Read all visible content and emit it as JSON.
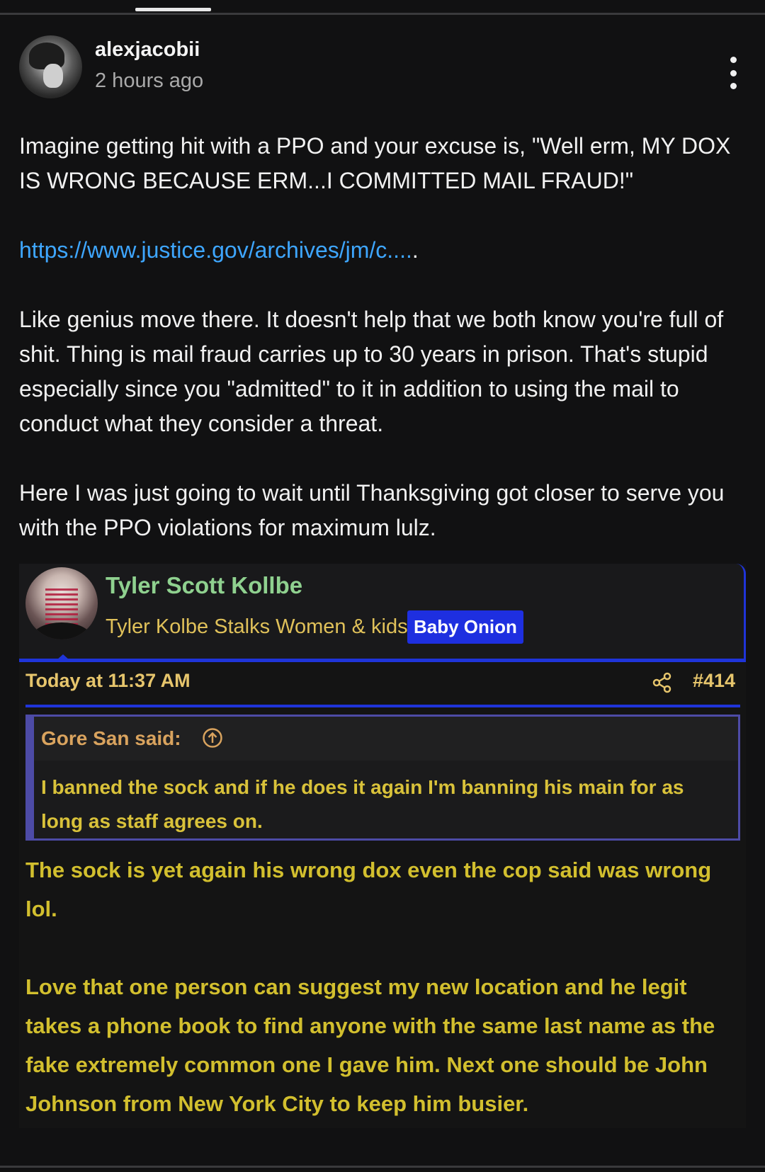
{
  "post": {
    "author": "alexjacobii",
    "timestamp": "2 hours ago",
    "paragraphs": [
      "Imagine getting hit with a PPO and your excuse is, \"Well erm, MY DOX IS WRONG BECAUSE ERM...I COMMITTED MAIL FRAUD!\"",
      "Like genius move there. It doesn't help that we both know you're full of shit. Thing is mail fraud carries up to 30 years in prison. That's stupid especially since you \"admitted\" to it in addition to using the mail to conduct what they consider a threat.",
      "Here I was just going to wait until Thanksgiving got closer to serve you with the PPO violations for maximum lulz."
    ],
    "link_text": "https://www.justice.gov/archives/jm/c....",
    "link_trailing": "."
  },
  "embed": {
    "name": "Tyler Scott Kollbe",
    "tagline": "Tyler Kolbe Stalks Women & kids.",
    "badge": "Baby Onion",
    "time": "Today at 11:37 AM",
    "post_number": "#414",
    "quote": {
      "author": "Gore San said:",
      "text": "I banned the sock and if he does it again I'm banning his main for as long as staff agrees on."
    },
    "reply": [
      "The sock is yet again his wrong dox even the cop said was wrong lol.",
      "Love that one person can suggest my new location and he legit takes a phone book to find anyone with the same last name as the fake extremely common one I gave him. Next one should be John Johnson from New York City to keep him busier."
    ]
  },
  "colors": {
    "background": "#111112",
    "link": "#3ea6ff",
    "embed_accent": "#1f34d9",
    "embed_name": "#8fd18f",
    "embed_gold": "#e6c56c",
    "reply_yellow": "#d2bf2e"
  },
  "icons": [
    "more-vertical-icon",
    "share-icon",
    "arrow-up-circle-icon"
  ]
}
